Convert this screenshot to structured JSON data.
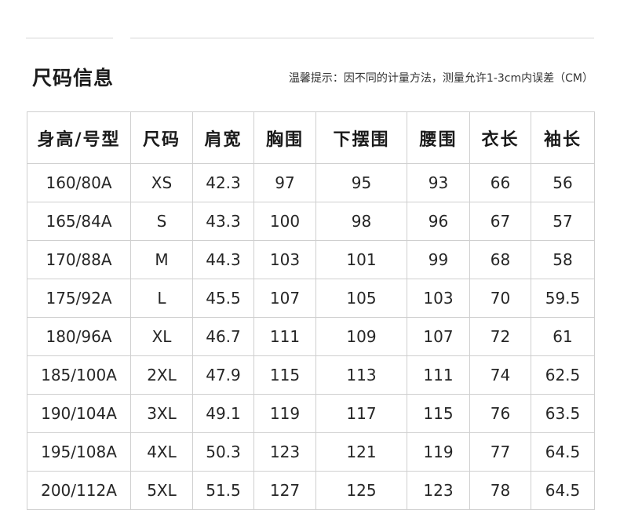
{
  "header": {
    "title": "尺码信息",
    "tip": "温馨提示：因不同的计量方法，测量允许1-3cm内误差（CM）"
  },
  "table": {
    "columns": [
      "身高/号型",
      "尺码",
      "肩宽",
      "胸围",
      "下摆围",
      "腰围",
      "衣长",
      "袖长"
    ],
    "rows": [
      [
        "160/80A",
        "XS",
        "42.3",
        "97",
        "95",
        "93",
        "66",
        "56"
      ],
      [
        "165/84A",
        "S",
        "43.3",
        "100",
        "98",
        "96",
        "67",
        "57"
      ],
      [
        "170/88A",
        "M",
        "44.3",
        "103",
        "101",
        "99",
        "68",
        "58"
      ],
      [
        "175/92A",
        "L",
        "45.5",
        "107",
        "105",
        "103",
        "70",
        "59.5"
      ],
      [
        "180/96A",
        "XL",
        "46.7",
        "111",
        "109",
        "107",
        "72",
        "61"
      ],
      [
        "185/100A",
        "2XL",
        "47.9",
        "115",
        "113",
        "111",
        "74",
        "62.5"
      ],
      [
        "190/104A",
        "3XL",
        "49.1",
        "119",
        "117",
        "115",
        "76",
        "63.5"
      ],
      [
        "195/108A",
        "4XL",
        "50.3",
        "123",
        "121",
        "119",
        "77",
        "64.5"
      ],
      [
        "200/112A",
        "5XL",
        "51.5",
        "127",
        "125",
        "123",
        "78",
        "64.5"
      ]
    ]
  }
}
